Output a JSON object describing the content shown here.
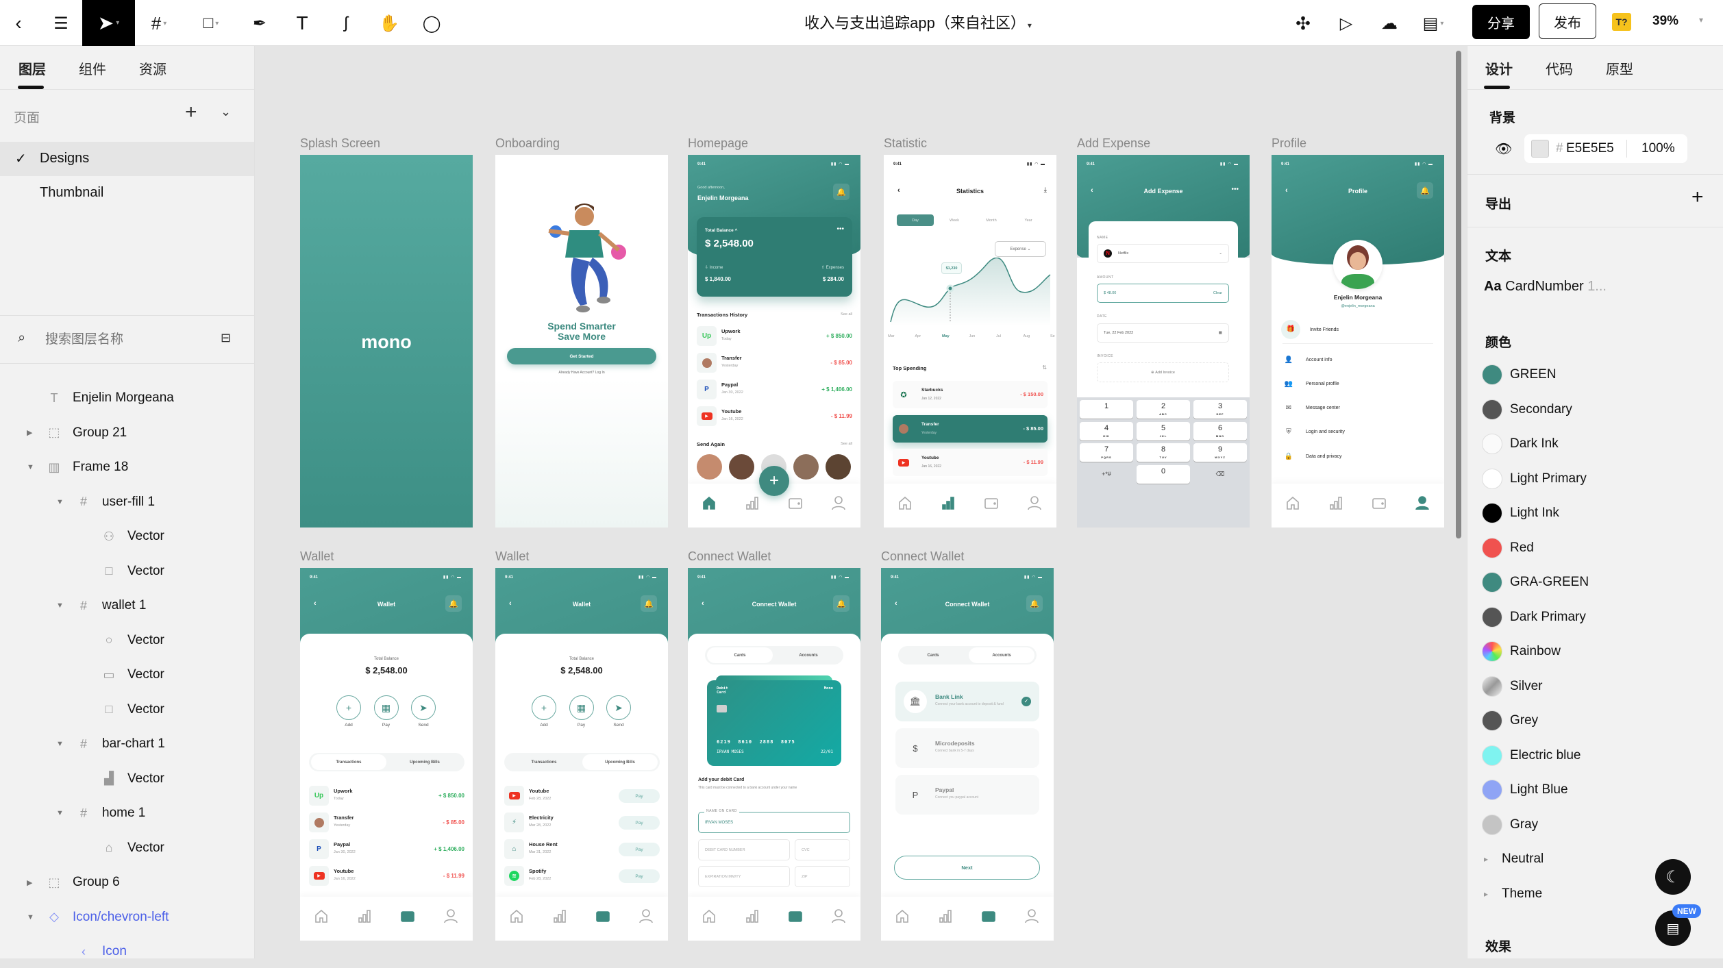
{
  "toolbar": {
    "title": "收入与支出追踪app（来自社区）",
    "share": "分享",
    "publish": "发布",
    "plugin_badge": "T?",
    "zoom": "39%"
  },
  "left_panel": {
    "tabs": [
      "图层",
      "组件",
      "资源"
    ],
    "pages_label": "页面",
    "pages": [
      {
        "name": "Designs",
        "selected": true
      },
      {
        "name": "Thumbnail",
        "selected": false
      }
    ],
    "search_placeholder": "搜索图层名称",
    "layers": [
      {
        "name": "Enjelin Morgeana",
        "icon": "text-icon",
        "depth": 0,
        "toggle": "none"
      },
      {
        "name": "Group 21",
        "icon": "group-icon",
        "depth": 0,
        "toggle": "collapsed"
      },
      {
        "name": "Frame 18",
        "icon": "columns-frame-icon",
        "depth": 0,
        "toggle": "expanded"
      },
      {
        "name": "user-fill 1",
        "icon": "frame-icon",
        "depth": 1,
        "toggle": "expanded"
      },
      {
        "name": "Vector",
        "icon": "person-icon",
        "depth": 2,
        "toggle": "none"
      },
      {
        "name": "Vector",
        "icon": "square-icon",
        "depth": 2,
        "toggle": "none"
      },
      {
        "name": "wallet 1",
        "icon": "frame-icon",
        "depth": 1,
        "toggle": "expanded"
      },
      {
        "name": "Vector",
        "icon": "circle-icon",
        "depth": 2,
        "toggle": "none"
      },
      {
        "name": "Vector",
        "icon": "wallet-icon",
        "depth": 2,
        "toggle": "none"
      },
      {
        "name": "Vector",
        "icon": "square-icon",
        "depth": 2,
        "toggle": "none"
      },
      {
        "name": "bar-chart 1",
        "icon": "frame-icon",
        "depth": 1,
        "toggle": "expanded"
      },
      {
        "name": "Vector",
        "icon": "bar-chart-icon",
        "depth": 2,
        "toggle": "none"
      },
      {
        "name": "home 1",
        "icon": "frame-icon",
        "depth": 1,
        "toggle": "expanded"
      },
      {
        "name": "Vector",
        "icon": "home-icon",
        "depth": 2,
        "toggle": "none"
      },
      {
        "name": "Group 6",
        "icon": "group-icon",
        "depth": 0,
        "toggle": "collapsed"
      },
      {
        "name": "Icon/chevron-left",
        "icon": "component-icon",
        "depth": 0,
        "toggle": "expanded",
        "component": true
      },
      {
        "name": "Icon",
        "icon": "chevron-left-icon",
        "depth": 1,
        "toggle": "none",
        "component": true
      }
    ]
  },
  "right_panel": {
    "tabs": [
      "设计",
      "代码",
      "原型"
    ],
    "background_label": "背景",
    "background_hex_prefix": "#",
    "background_hex": "E5E5E5",
    "background_opacity": "100%",
    "export_label": "导出",
    "text_label": "文本",
    "text_style_prefix": "Aa",
    "text_style": "CardNumber",
    "text_style_suffix": "1...",
    "colors_label": "颜色",
    "colors": [
      {
        "name": "GREEN",
        "hex": "#3f8a80"
      },
      {
        "name": "Secondary",
        "hex": "#555555"
      },
      {
        "name": "Dark Ink",
        "hex": "#fafafa"
      },
      {
        "name": "Light Primary",
        "hex": "#ffffff"
      },
      {
        "name": "Light Ink",
        "hex": "#000000"
      },
      {
        "name": "Red",
        "hex": "#f0524f"
      },
      {
        "name": "GRA-GREEN",
        "hex": "#3f8a80"
      },
      {
        "name": "Dark Primary",
        "hex": "#555555"
      },
      {
        "name": "Rainbow",
        "hex": "rainbow"
      },
      {
        "name": "Silver",
        "hex": "silver"
      },
      {
        "name": "Grey",
        "hex": "#555555"
      },
      {
        "name": "Electric blue",
        "hex": "#7ff3f0"
      },
      {
        "name": "Light Blue",
        "hex": "#8fa4f5"
      },
      {
        "name": "Gray",
        "hex": "#c4c4c4"
      }
    ],
    "groups": [
      "Neutral",
      "Theme"
    ],
    "effects_label": "效果",
    "new_badge": "NEW"
  },
  "canvas": {
    "frames": [
      "Splash Screen",
      "Onboarding",
      "Homepage",
      "Statistic",
      "Add Expense",
      "Profile",
      "Wallet",
      "Wallet",
      "Connect Wallet",
      "Connect Wallet"
    ]
  },
  "screens": {
    "status_time": "9:41",
    "splash": {
      "logo": "mono"
    },
    "onboarding": {
      "title1": "Spend Smarter",
      "title2": "Save More",
      "button": "Get Started",
      "footer": "Already Have Account? Log In"
    },
    "homepage": {
      "greeting": "Good afternoon,",
      "name": "Enjelin Morgeana",
      "balance_label": "Total Balance ^",
      "balance": "$ 2,548.00",
      "income_label": "Income",
      "income": "$ 1,840.00",
      "expenses_label": "Expenses",
      "expenses": "$ 284.00",
      "history_title": "Transactions History",
      "see_all": "See all",
      "send_again": "Send Again",
      "transactions": [
        {
          "name": "Upwork",
          "sub": "Today",
          "amount": "+ $ 850.00",
          "kind": "pos",
          "icon": "upwork-logo"
        },
        {
          "name": "Transfer",
          "sub": "Yesterday",
          "amount": "- $ 85.00",
          "kind": "neg",
          "icon": "avatar"
        },
        {
          "name": "Paypal",
          "sub": "Jan 30, 2022",
          "amount": "+ $ 1,406.00",
          "kind": "pos",
          "icon": "paypal-logo"
        },
        {
          "name": "Youtube",
          "sub": "Jan 16, 2022",
          "amount": "- $ 11.99",
          "kind": "neg",
          "icon": "youtube-logo"
        }
      ]
    },
    "statistic": {
      "title": "Statistics",
      "periods": [
        "Day",
        "Week",
        "Month",
        "Year"
      ],
      "dropdown": "Expense",
      "tooltip": "$1,230",
      "months": [
        "Mar",
        "Apr",
        "May",
        "Jun",
        "Jul",
        "Aug",
        "Se"
      ],
      "selected_month": "May",
      "top_spending": "Top Spending",
      "rows": [
        {
          "name": "Starbucks",
          "sub": "Jan 12, 2022",
          "amount": "- $ 150.00",
          "icon": "starbucks-logo"
        },
        {
          "name": "Transfer",
          "sub": "Yesterday",
          "amount": "- $ 85.00",
          "icon": "avatar",
          "highlight": true
        },
        {
          "name": "Youtube",
          "sub": "Jan 16, 2022",
          "amount": "- $ 11.99",
          "icon": "youtube-logo"
        }
      ]
    },
    "add_expense": {
      "title": "Add Expense",
      "name_label": "NAME",
      "name_value": "Netflix",
      "amount_label": "AMOUNT",
      "amount_value": "$ 48.00",
      "clear": "Clear",
      "date_label": "DATE",
      "date_value": "Tue, 22 Feb 2022",
      "invoice_label": "INVOICE",
      "add_invoice": "Add Invoice",
      "keys": [
        [
          "1",
          ""
        ],
        [
          "2",
          "ABC"
        ],
        [
          "3",
          "DEF"
        ],
        [
          "4",
          "GHI"
        ],
        [
          "5",
          "JKL"
        ],
        [
          "6",
          "MNO"
        ],
        [
          "7",
          "PQRS"
        ],
        [
          "8",
          "TUV"
        ],
        [
          "9",
          "WXYZ"
        ],
        [
          "+*#",
          ""
        ],
        [
          "0",
          ""
        ],
        [
          "⌫",
          ""
        ]
      ]
    },
    "profile": {
      "title": "Profile",
      "name": "Enjelin Morgeana",
      "handle": "@enjelin_morgeana",
      "items": [
        {
          "label": "Invite Friends",
          "icon": "gift-icon"
        },
        {
          "label": "Account info",
          "icon": "person-icon"
        },
        {
          "label": "Personal profile",
          "icon": "people-icon"
        },
        {
          "label": "Message center",
          "icon": "mail-icon"
        },
        {
          "label": "Login and security",
          "icon": "shield-icon"
        },
        {
          "label": "Data and privacy",
          "icon": "lock-icon"
        }
      ]
    },
    "wallet": {
      "title": "Wallet",
      "balance_label": "Total Balance",
      "balance": "$ 2,548.00",
      "actions": [
        "Add",
        "Pay",
        "Send"
      ],
      "tabs": [
        "Transactions",
        "Upcoming Bills"
      ],
      "bills": [
        {
          "name": "Youtube",
          "sub": "Feb 28, 2022",
          "icon": "youtube-logo"
        },
        {
          "name": "Electricity",
          "sub": "Mar 28, 2022",
          "icon": "lightning-icon"
        },
        {
          "name": "House Rent",
          "sub": "Mar 31, 2022",
          "icon": "house-icon"
        },
        {
          "name": "Spotify",
          "sub": "Feb 28, 2022",
          "icon": "spotify-logo"
        }
      ],
      "pay_label": "Pay"
    },
    "connect": {
      "title": "Connect Wallet",
      "tabs": [
        "Cards",
        "Accounts"
      ],
      "card_type": "Debit Card",
      "card_brand": "Mono",
      "card_number": "6219  8610  2888  8075",
      "card_holder": "IRVAN MOSES",
      "card_expiry": "22/01",
      "add_title": "Add your debit Card",
      "add_sub": "This card must be connected to a bank account under your name",
      "name_label": "NAME ON CARD",
      "name_value": "IRVAN MOSES",
      "ph_number": "DEBIT CARD NUMBER",
      "ph_cvc": "CVC",
      "ph_exp": "EXPIRATION MM/YY",
      "ph_zip": "ZIP",
      "options": [
        {
          "title": "Bank Link",
          "sub": "Connect your bank account to deposit & fund",
          "icon": "bank-icon",
          "selected": true
        },
        {
          "title": "Microdeposits",
          "sub": "Connect bank in 5-7 days",
          "icon": "dollar-icon"
        },
        {
          "title": "Paypal",
          "sub": "Connect you paypal account",
          "icon": "paypal-icon"
        }
      ],
      "next": "Next"
    }
  }
}
